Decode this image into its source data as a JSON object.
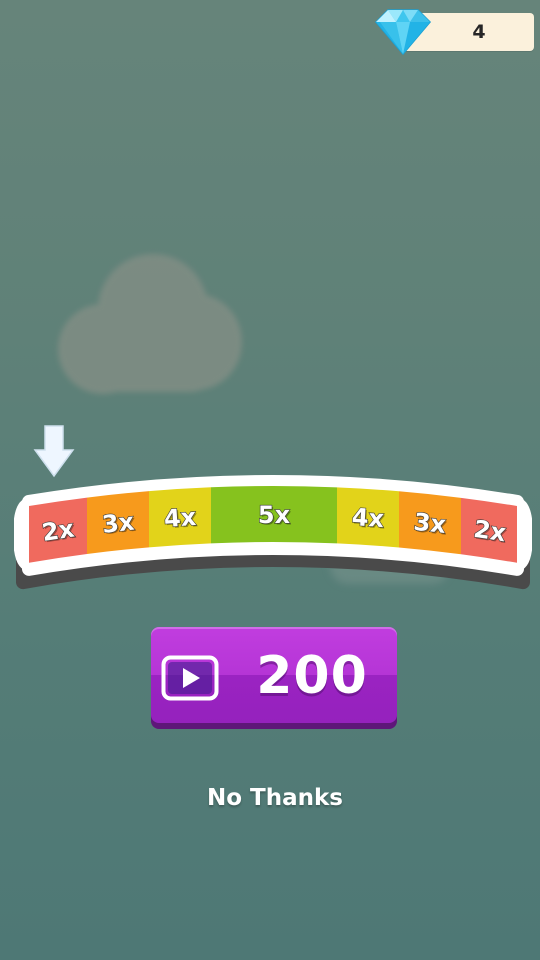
{
  "hud": {
    "gem_icon": "diamond-icon",
    "gem_count": "4"
  },
  "multiplier_bar": {
    "pointer_icon": "down-arrow-icon",
    "segments": [
      {
        "label": "2x",
        "color": "#f06a5e"
      },
      {
        "label": "3x",
        "color": "#f79a1c"
      },
      {
        "label": "4x",
        "color": "#e2d31a"
      },
      {
        "label": "5x",
        "color": "#86c21e"
      },
      {
        "label": "4x",
        "color": "#e2d31a"
      },
      {
        "label": "3x",
        "color": "#f79a1c"
      },
      {
        "label": "2x",
        "color": "#f06a5e"
      }
    ]
  },
  "reward_button": {
    "icon": "play-video-icon",
    "amount": "200",
    "color": "#b535d6"
  },
  "no_thanks_label": "No Thanks"
}
